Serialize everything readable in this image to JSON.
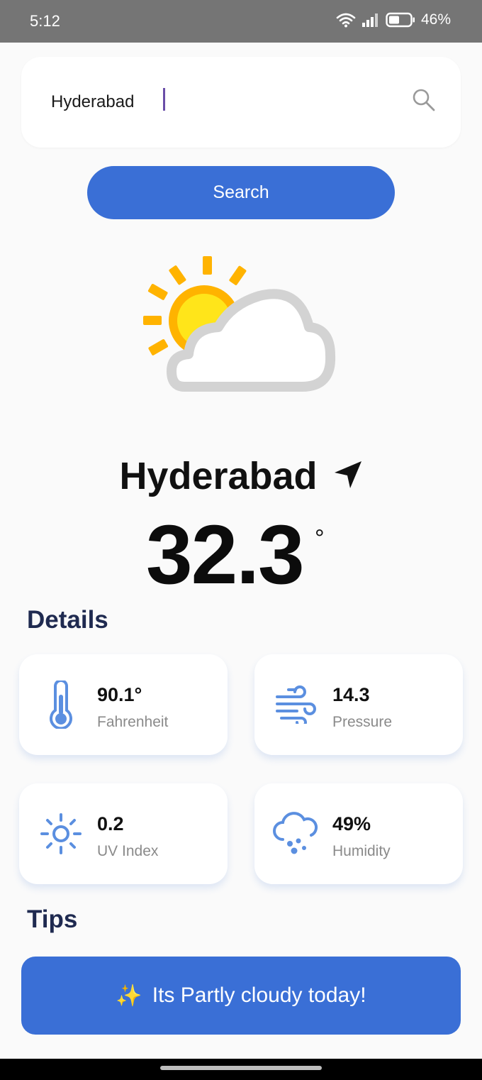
{
  "status_bar": {
    "time": "5:12",
    "battery": "46%",
    "icons": [
      "wifi-icon",
      "signal-icon",
      "battery-icon"
    ]
  },
  "search": {
    "value": "Hyderabad",
    "placeholder": "",
    "button_label": "Search",
    "icon": "search-icon"
  },
  "current": {
    "condition_icon": "partly-cloudy-icon",
    "city": "Hyderabad",
    "location_icon": "navigation-arrow-icon",
    "temperature": "32.3",
    "unit_symbol": "°"
  },
  "details": {
    "title": "Details",
    "items": [
      {
        "value": "90.1°",
        "label": "Fahrenheit",
        "icon": "thermometer-icon"
      },
      {
        "value": "14.3",
        "label": "Pressure",
        "icon": "wind-icon"
      },
      {
        "value": "0.2",
        "label": "UV Index",
        "icon": "sun-icon"
      },
      {
        "value": "49%",
        "label": "Humidity",
        "icon": "rain-cloud-icon"
      }
    ]
  },
  "tips": {
    "title": "Tips",
    "emoji": "✨",
    "message": "Its Partly cloudy today!"
  },
  "colors": {
    "accent": "#3a6fd6",
    "status_bar": "#757575",
    "section_title": "#1f2a50",
    "icon_blue": "#5b8fe0"
  }
}
